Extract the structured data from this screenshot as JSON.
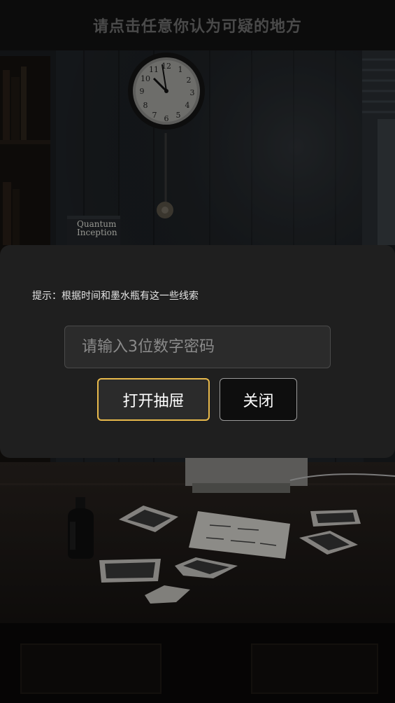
{
  "header": {
    "title": "请点击任意你认为可疑的地方"
  },
  "scene": {
    "book_title": "Quantum Inception",
    "note_text": "—··—·· —··—·",
    "clock": {
      "hour_hand": "10",
      "minute_hand": "11"
    }
  },
  "modal": {
    "hint": "提示：根据时间和墨水瓶有这一些线索",
    "code_input": {
      "placeholder": "请输入3位数字密码",
      "value": ""
    },
    "open_button_label": "打开抽屉",
    "close_button_label": "关闭"
  },
  "colors": {
    "accent_border": "#e8b94b",
    "modal_bg": "#1f1f1f",
    "title_text": "#4a4a4a"
  }
}
